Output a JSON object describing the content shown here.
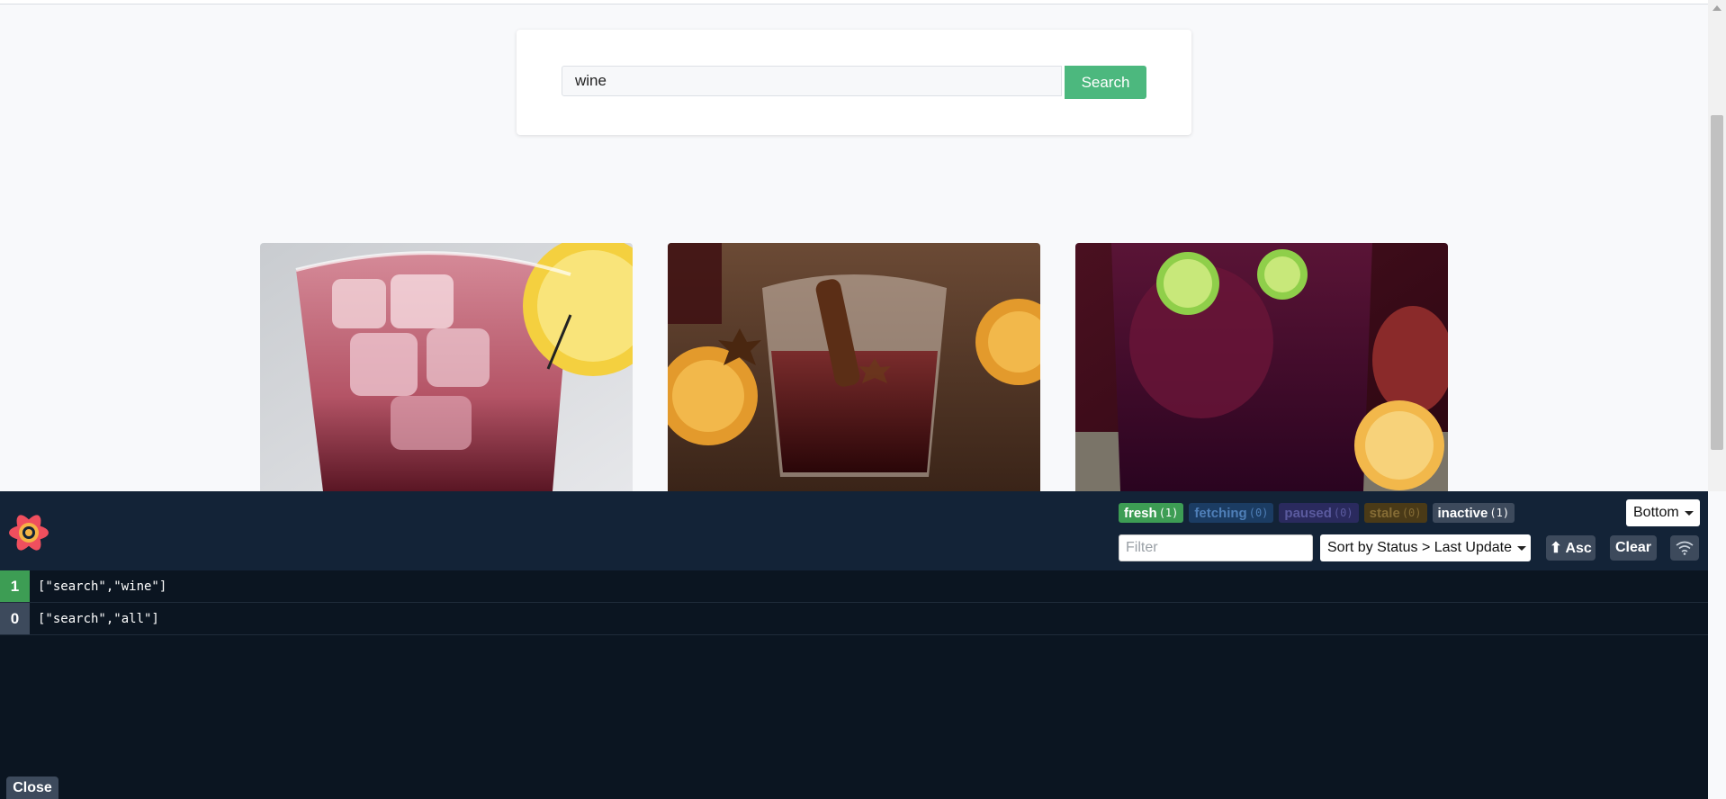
{
  "search": {
    "value": "wine",
    "button_label": "Search"
  },
  "results": [
    {
      "image": "iced-red-drink-with-lemon-photo"
    },
    {
      "image": "mulled-wine-with-cinnamon-and-star-anise-photo"
    },
    {
      "image": "red-sangria-with-lime-photo"
    }
  ],
  "devtools": {
    "status_badges": [
      {
        "label": "fresh",
        "count": "(1)",
        "color": "#3d9d54"
      },
      {
        "label": "fetching",
        "count": "(0)",
        "color": "#1b3c63"
      },
      {
        "label": "paused",
        "count": "(0)",
        "color": "#2a2a5e"
      },
      {
        "label": "stale",
        "count": "(0)",
        "color": "#4a3a17"
      },
      {
        "label": "inactive",
        "count": "(1)",
        "color": "#3d4a5c"
      }
    ],
    "position_select": "Bottom",
    "filter_placeholder": "Filter",
    "sort_select": "Sort by Status > Last Update",
    "asc_button": "⬆ Asc",
    "clear_button": "Clear",
    "queries": [
      {
        "count": "1",
        "key": "[\"search\",\"wine\"]",
        "status": "fresh"
      },
      {
        "count": "0",
        "key": "[\"search\",\"all\"]",
        "status": "inactive"
      }
    ],
    "close_button": "Close"
  }
}
